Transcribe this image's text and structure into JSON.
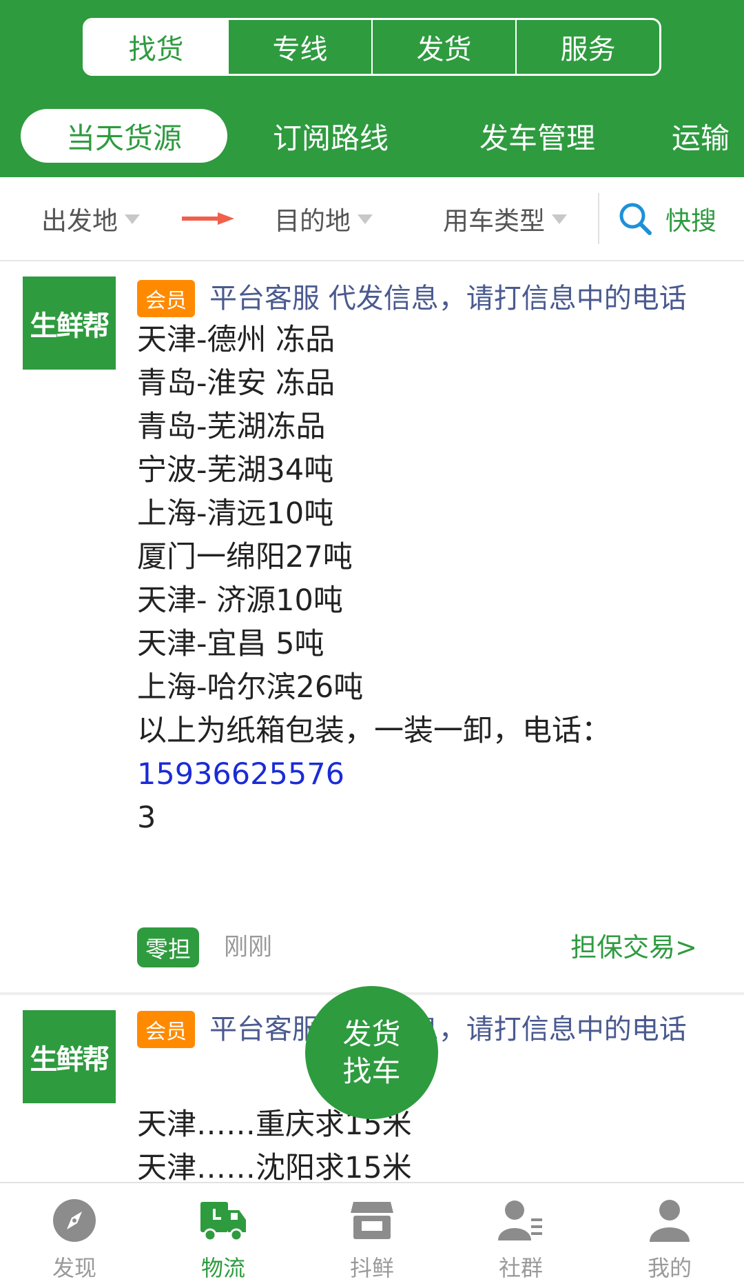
{
  "header": {
    "segments": [
      {
        "label": "找货",
        "active": true
      },
      {
        "label": "专线",
        "active": false
      },
      {
        "label": "发货",
        "active": false
      },
      {
        "label": "服务",
        "active": false
      }
    ],
    "subtabs": [
      {
        "label": "当天货源",
        "active": true
      },
      {
        "label": "订阅路线",
        "active": false
      },
      {
        "label": "发车管理",
        "active": false
      },
      {
        "label": "运输",
        "active": false
      }
    ]
  },
  "filter": {
    "origin": "出发地",
    "destination": "目的地",
    "vehicle_type": "用车类型",
    "quick_search": "快搜"
  },
  "cards": [
    {
      "logo_text": "生鲜帮",
      "badge": "会员",
      "title": "平台客服 代发信息，请打信息中的电话",
      "lines": [
        "天津-德州 冻品",
        "青岛-淮安 冻品",
        "青岛-芜湖冻品",
        "宁波-芜湖34吨",
        "上海-清远10吨",
        "厦门一绵阳27吨",
        "天津- 济源10吨",
        "天津-宜昌 5吨",
        "上海-哈尔滨26吨",
        "以上为纸箱包装，一装一卸，电话："
      ],
      "phone": "15936625576",
      "tail": "3",
      "tag": "零担",
      "time": "刚刚",
      "guarantee": "担保交易>"
    },
    {
      "logo_text": "生鲜帮",
      "badge": "会员",
      "title": "平台客服 代发信息，请打信息中的电话",
      "lines": [
        "天津……重庆求15米",
        "天津……沈阳求15米"
      ]
    }
  ],
  "fab": {
    "line1": "发货",
    "line2": "找车"
  },
  "bottom_nav": [
    {
      "label": "发现",
      "icon": "compass-icon",
      "active": false
    },
    {
      "label": "物流",
      "icon": "truck-icon",
      "active": true
    },
    {
      "label": "抖鲜",
      "icon": "store-icon",
      "active": false
    },
    {
      "label": "社群",
      "icon": "contacts-icon",
      "active": false
    },
    {
      "label": "我的",
      "icon": "user-icon",
      "active": false
    }
  ],
  "colors": {
    "brand_green": "#2e9b3f",
    "vip_orange": "#ff8a00",
    "title_blue": "#4a5a8f",
    "phone_blue": "#1a2bd6",
    "nav_grey": "#9a9a9a"
  }
}
